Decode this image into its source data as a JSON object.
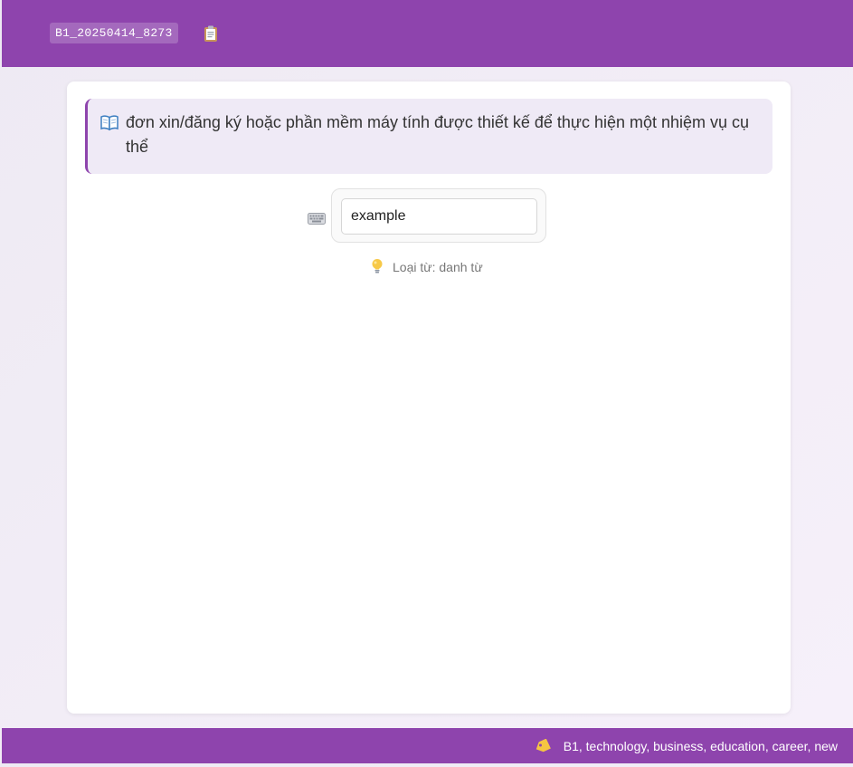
{
  "header": {
    "card_id": "B1_20250414_8273",
    "copy_icon": "clipboard-icon"
  },
  "definition": {
    "icon": "open-book-icon",
    "text": "đơn xin/đăng ký hoặc phần mềm máy tính được thiết kế để thực hiện một nhiệm vụ cụ thể"
  },
  "answer": {
    "icon": "keyboard-icon",
    "value": "example"
  },
  "hint": {
    "icon": "light-bulb-icon",
    "text": "Loại từ: danh từ"
  },
  "footer": {
    "icon": "tag-icon",
    "tags": "B1, technology, business, education, career, new"
  },
  "colors": {
    "primary": "#8e44ad",
    "definition_bg": "#efeaf6",
    "page_bg": "#f2eef7"
  }
}
